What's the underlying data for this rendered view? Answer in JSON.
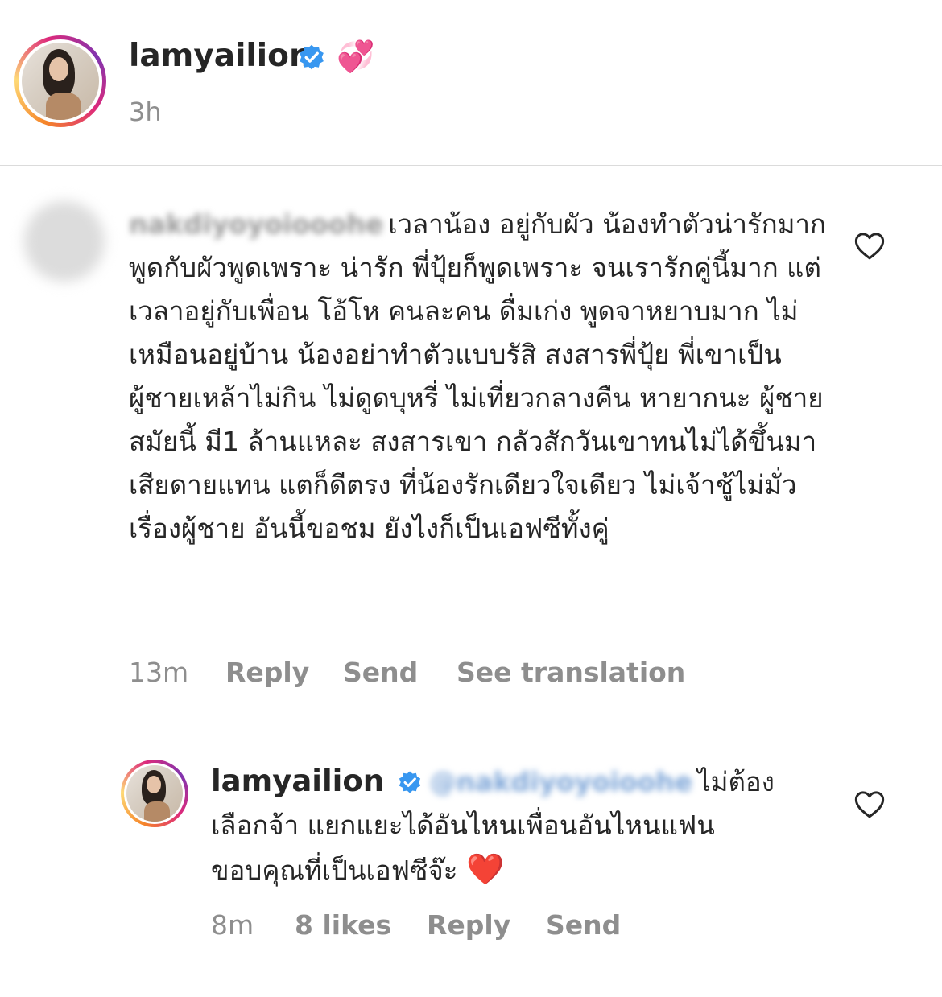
{
  "post": {
    "username": "lamyailion",
    "verified_icon": "verified-badge-icon",
    "emoji": "💞",
    "time": "3h"
  },
  "comment": {
    "username_blurred": "nakdiyoyoiooohe",
    "text": "เวลาน้อง อยู่กับผัว น้องทำตัวน่ารักมาก พูดกับผัวพูดเพราะ น่ารัก พี่ปุ้ยก็พูดเพราะ จนเรารักคู่นี้มาก  แต่เวลาอยู่กับเพื่อน โอ้โห คนละคน ดื่มเก่ง พูดจาหยาบมาก ไม่เหมือนอยู่บ้าน น้องอย่าทำตัวแบบรัสิ สงสารพี่ปุ้ย พี่เขาเป็นผู้ชายเหล้าไม่กิน ไม่ดูดบุหรี่ ไม่เที่ยวกลางคืน หายากนะ ผู้ชาย สมัยนี้ มี1 ล้านแหละ สงสารเขา กลัวสักวันเขาทนไม่ได้ขึ้นมาเสียดายแทน  แตก็ดีตรง ที่น้องรักเดียวใจเดียว ไม่เจ้าชู้ไม่มั่วเรื่องผู้ชาย อันนี้ขอชม ยังไงก็เป็นเอฟซีทั้งคู่",
    "time": "13m",
    "reply_label": "Reply",
    "send_label": "Send",
    "translate_label": "See translation"
  },
  "reply": {
    "username": "lamyailion",
    "mention_blurred": "@nakdiyoyoioohe",
    "text": "ไม่ต้องเลือกจ้า แยกแยะได้อันไหนเพื่อนอันไหนแฟน ขอบคุณที่เป็นเอฟซีจ๊ะ",
    "emoji": "❤️",
    "time": "8m",
    "likes": "8 likes",
    "reply_label": "Reply",
    "send_label": "Send"
  },
  "icons": {
    "like": "heart-outline-icon"
  },
  "colors": {
    "text": "#262626",
    "muted": "#8e8e8e",
    "verified": "#3897f0",
    "divider": "#dbdbdb"
  }
}
